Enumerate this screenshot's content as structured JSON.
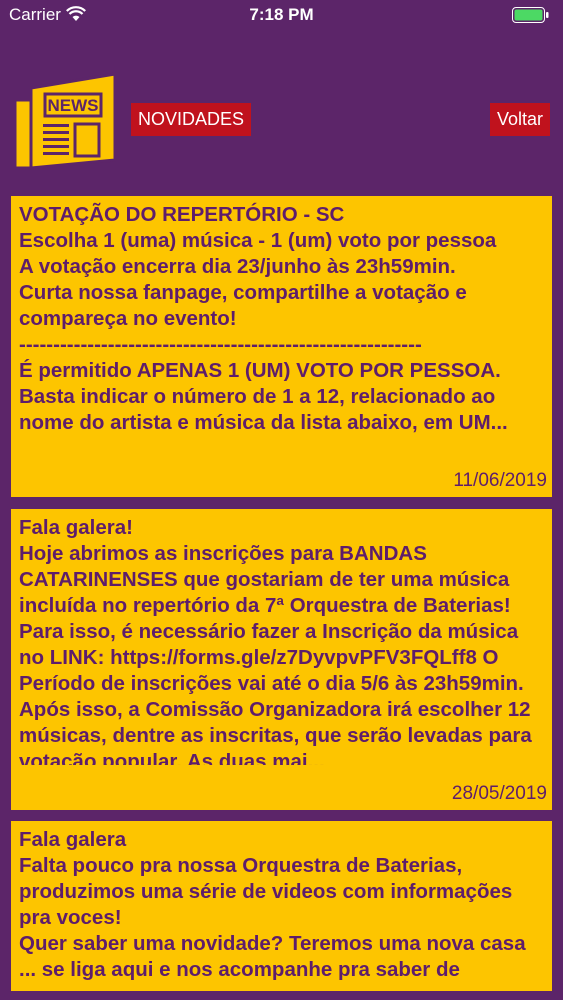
{
  "status_bar": {
    "carrier": "Carrier",
    "time": "7:18 PM"
  },
  "header": {
    "logo_text": "NEWS",
    "news_button": "NOVIDADES",
    "back_button": "Voltar"
  },
  "posts": [
    {
      "body": "VOTAÇÃO DO REPERTÓRIO - SC\nEscolha 1 (uma) música - 1 (um) voto por pessoa\nA votação encerra dia 23/junho às 23h59min.\nCurta nossa fanpage, compartilhe a votação e compareça no evento!\n-----------------------------------------------------------\nÉ permitido APENAS 1 (UM) VOTO POR PESSOA.\nBasta indicar o número de 1 a 12, relacionado ao nome do artista e música da lista abaixo, em UM...",
      "date": "11/06/2019"
    },
    {
      "body": "Fala galera!\nHoje abrimos as inscrições para BANDAS CATARINENSES que gostariam de ter uma música incluída no repertório da 7ª Orquestra de Baterias!\nPara isso, é necessário fazer a Inscrição da música no LINK: https://forms.gle/z7DyvpvPFV3FQLff8 O Período de inscrições vai até o dia 5/6 às 23h59min. Após isso, a Comissão Organizadora irá escolher 12 músicas, dentre as inscritas, que serão levadas para votação popular. As duas mai...",
      "date": "28/05/2019"
    },
    {
      "body": "Fala galera\nFalta pouco pra nossa Orquestra de Baterias, produzimos uma série de videos com informações pra voces!\nQuer saber uma novidade? Teremos uma nova casa ... se liga aqui e nos acompanhe pra saber de",
      "date": ""
    }
  ],
  "colors": {
    "background": "#5c2569",
    "card": "#fdc500",
    "card_text": "#5e1d6b",
    "button": "#c0121d"
  }
}
